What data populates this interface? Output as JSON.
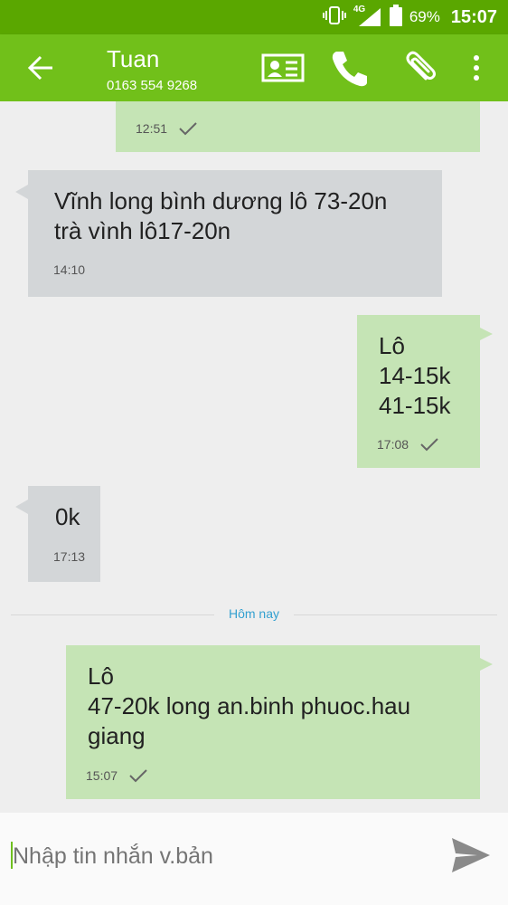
{
  "status_bar": {
    "network": "4G",
    "battery": "69%",
    "time": "15:07"
  },
  "header": {
    "contact_name": "Tuan",
    "contact_phone": "0163 554 9268"
  },
  "messages": [
    {
      "direction": "out",
      "text": "",
      "time": "12:51",
      "delivered": true
    },
    {
      "direction": "in",
      "text": "Vĩnh long bình dương lô 73-20n\ntrà vình lô17-20n",
      "time": "14:10"
    },
    {
      "direction": "out",
      "text": "Lô\n14-15k\n41-15k",
      "time": "17:08",
      "delivered": true
    },
    {
      "direction": "in",
      "text": "0k",
      "time": "17:13"
    },
    {
      "direction": "out",
      "text": "Lô\n47-20k long an.binh phuoc.hau\ngiang",
      "time": "15:07",
      "delivered": true
    }
  ],
  "date_divider": "Hôm nay",
  "composer": {
    "placeholder": "Nhập tin nhắn v.bản"
  },
  "colors": {
    "status_bar": "#5aa700",
    "app_bar": "#71c01a",
    "outgoing_bubble": "#c5e4b5",
    "incoming_bubble": "#d3d6d8",
    "divider_text": "#33a0d0"
  }
}
